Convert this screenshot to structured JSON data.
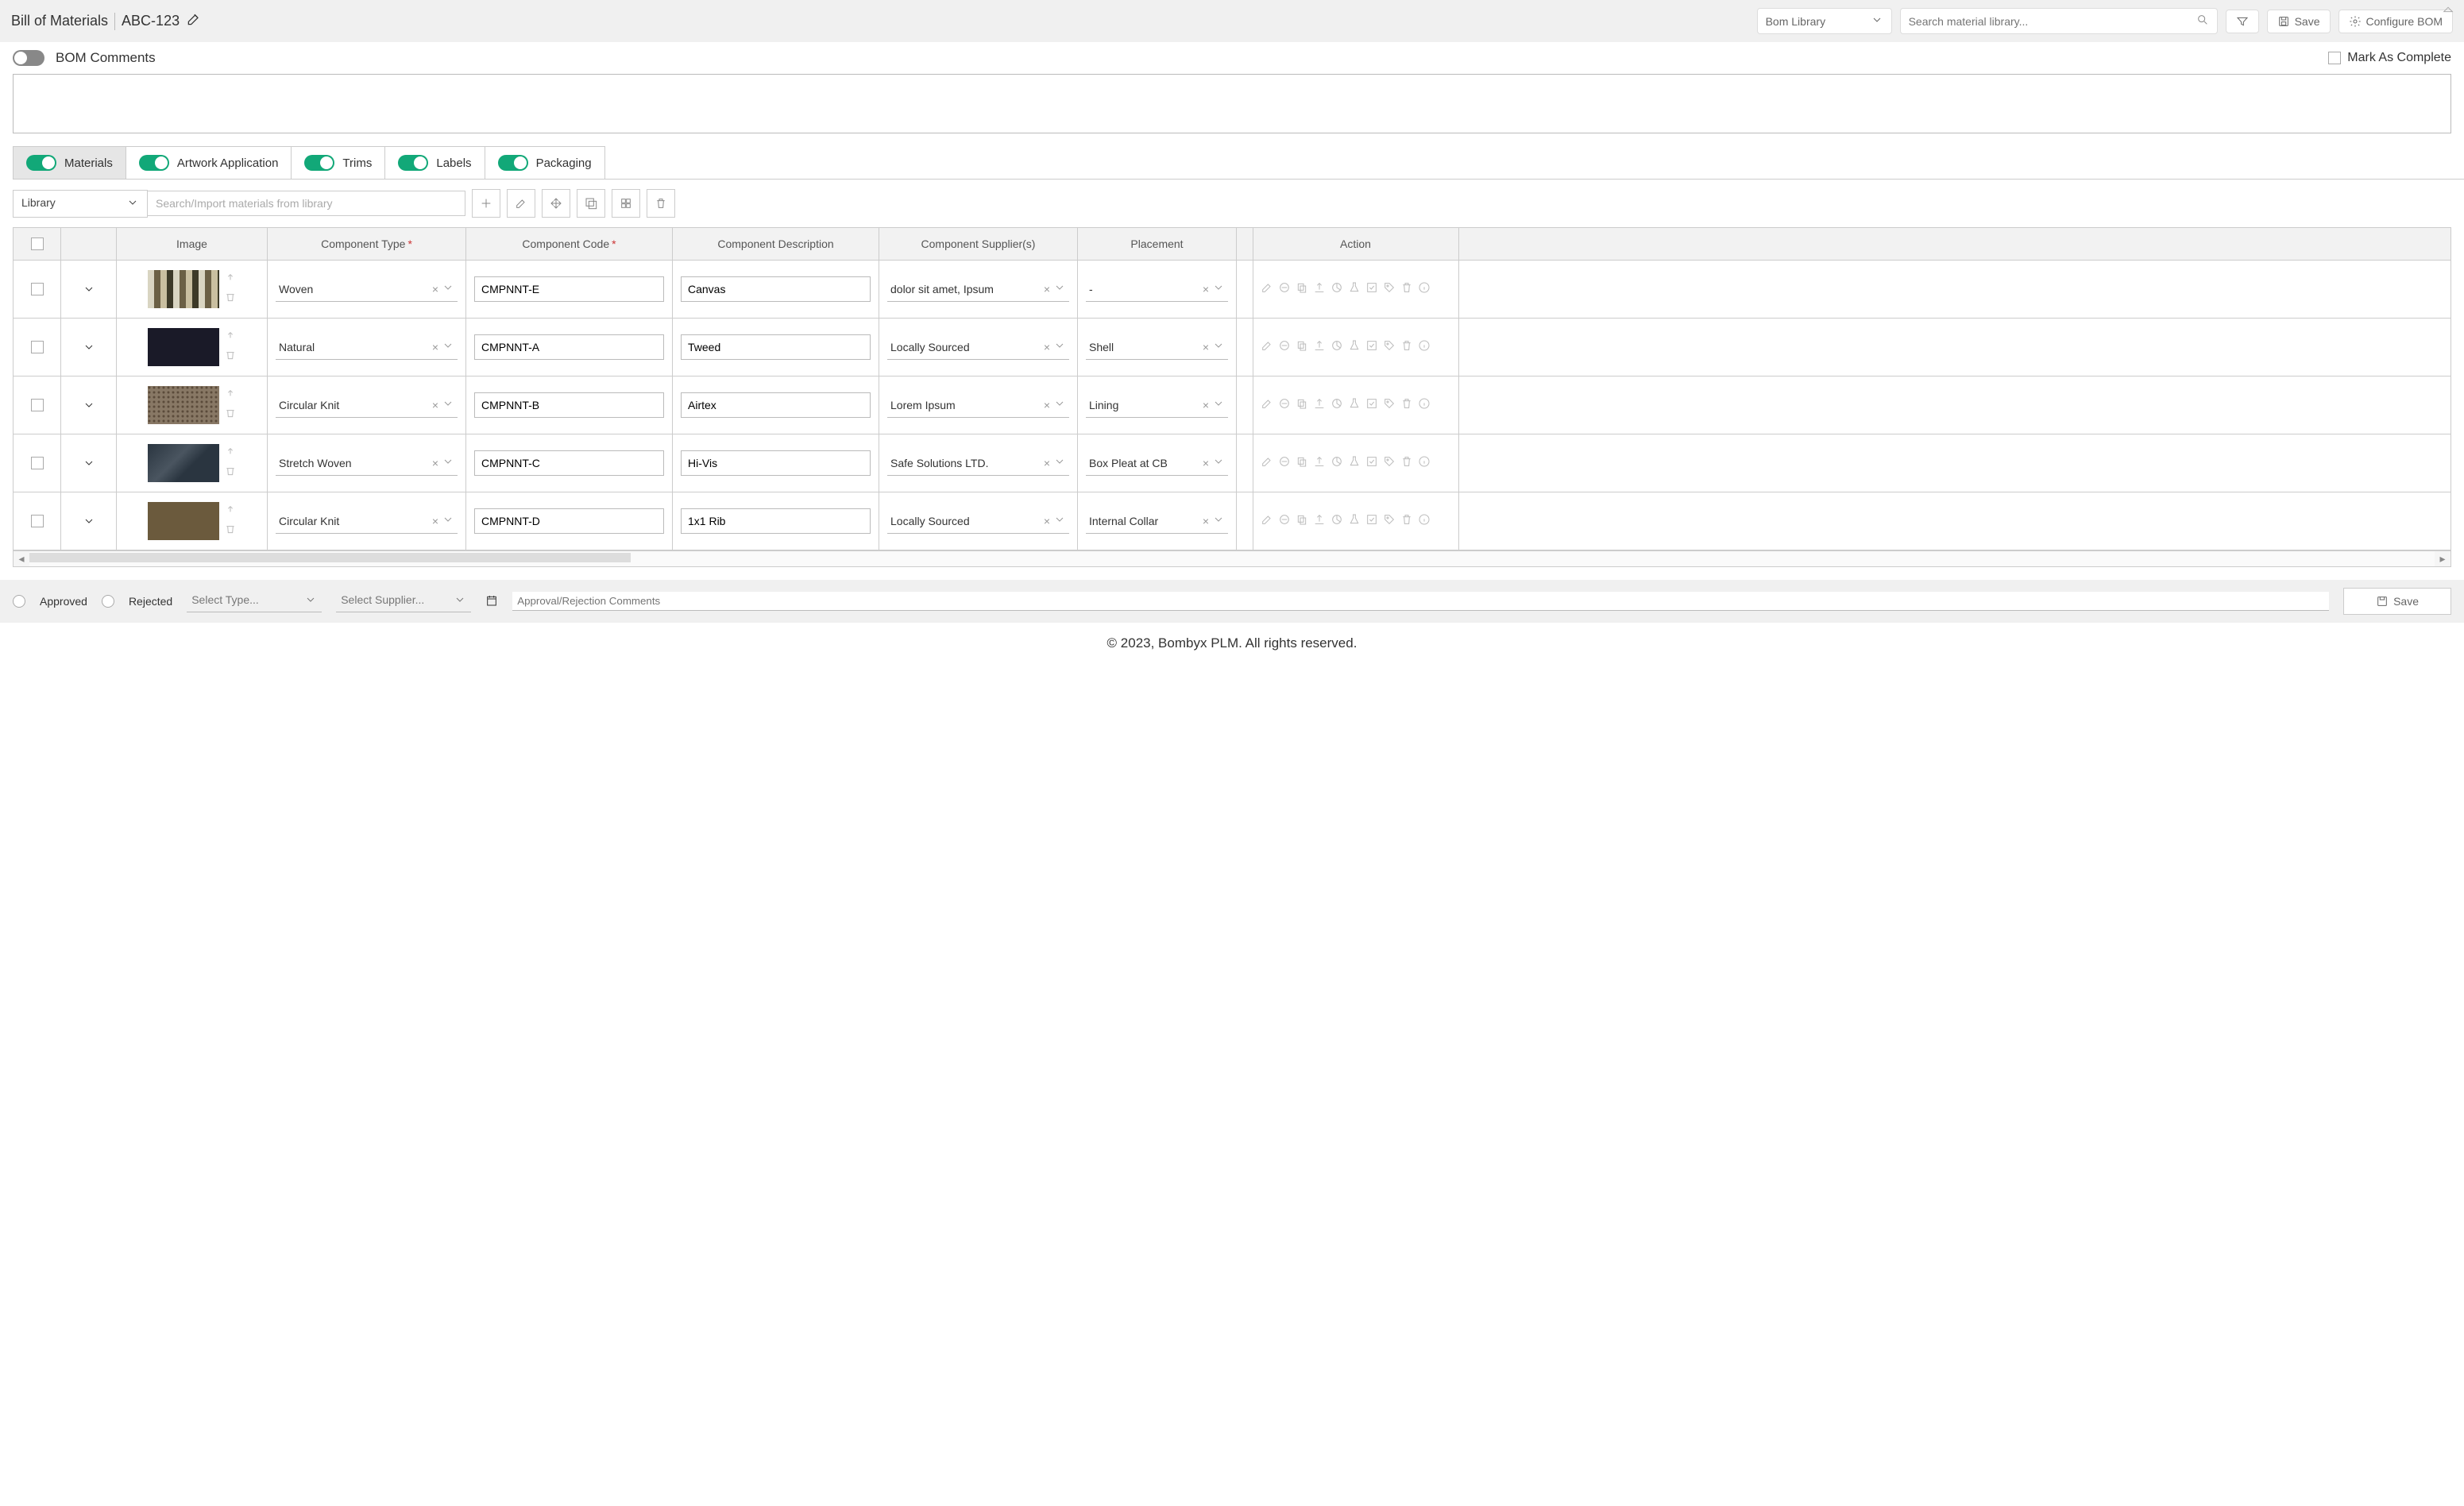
{
  "header": {
    "title": "Bill of Materials",
    "code": "ABC-123",
    "library_select": "Bom Library",
    "search_placeholder": "Search material library...",
    "save_label": "Save",
    "configure_label": "Configure BOM"
  },
  "subheader": {
    "comments_label": "BOM Comments",
    "mark_complete_label": "Mark As Complete"
  },
  "tabs": [
    {
      "label": "Materials",
      "active": true
    },
    {
      "label": "Artwork Application",
      "active": false
    },
    {
      "label": "Trims",
      "active": false
    },
    {
      "label": "Labels",
      "active": false
    },
    {
      "label": "Packaging",
      "active": false
    }
  ],
  "library_bar": {
    "select_label": "Library",
    "search_placeholder": "Search/Import materials from library"
  },
  "columns": {
    "image": "Image",
    "component_type": "Component Type",
    "component_code": "Component Code",
    "component_description": "Component Description",
    "component_suppliers": "Component Supplier(s)",
    "placement": "Placement",
    "action": "Action"
  },
  "rows": [
    {
      "type": "Woven",
      "code": "CMPNNT-E",
      "desc": "Canvas",
      "supplier": "dolor sit amet, Ipsum",
      "placement": "-"
    },
    {
      "type": "Natural",
      "code": "CMPNNT-A",
      "desc": "Tweed",
      "supplier": "Locally Sourced",
      "placement": "Shell"
    },
    {
      "type": "Circular Knit",
      "code": "CMPNNT-B",
      "desc": "Airtex",
      "supplier": "Lorem Ipsum",
      "placement": "Lining"
    },
    {
      "type": "Stretch Woven",
      "code": "CMPNNT-C",
      "desc": "Hi-Vis",
      "supplier": "Safe Solutions LTD.",
      "placement": "Box Pleat at CB"
    },
    {
      "type": "Circular Knit",
      "code": "CMPNNT-D",
      "desc": "1x1 Rib",
      "supplier": "Locally Sourced",
      "placement": "Internal Collar"
    }
  ],
  "footer": {
    "approved": "Approved",
    "rejected": "Rejected",
    "select_type": "Select Type...",
    "select_supplier": "Select Supplier...",
    "comments_placeholder": "Approval/Rejection Comments",
    "save": "Save"
  },
  "copyright": "© 2023, Bombyx PLM. All rights reserved."
}
